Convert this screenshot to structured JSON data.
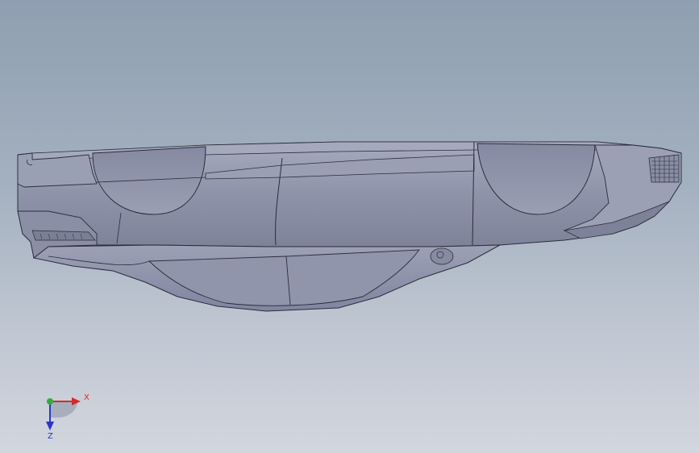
{
  "viewport": {
    "background_top": "#8f9fb1",
    "background_bottom": "#d2d6de"
  },
  "model": {
    "body_color": "#8e93aa",
    "edge_color": "#2a2d3a",
    "highlight_color": "#b7bccd",
    "shadow_color": "#6b7088"
  },
  "triad": {
    "x_label": "X",
    "z_label": "Z",
    "x_color": "#d8282a",
    "y_color": "#2fae3a",
    "z_color": "#2a35c8"
  }
}
